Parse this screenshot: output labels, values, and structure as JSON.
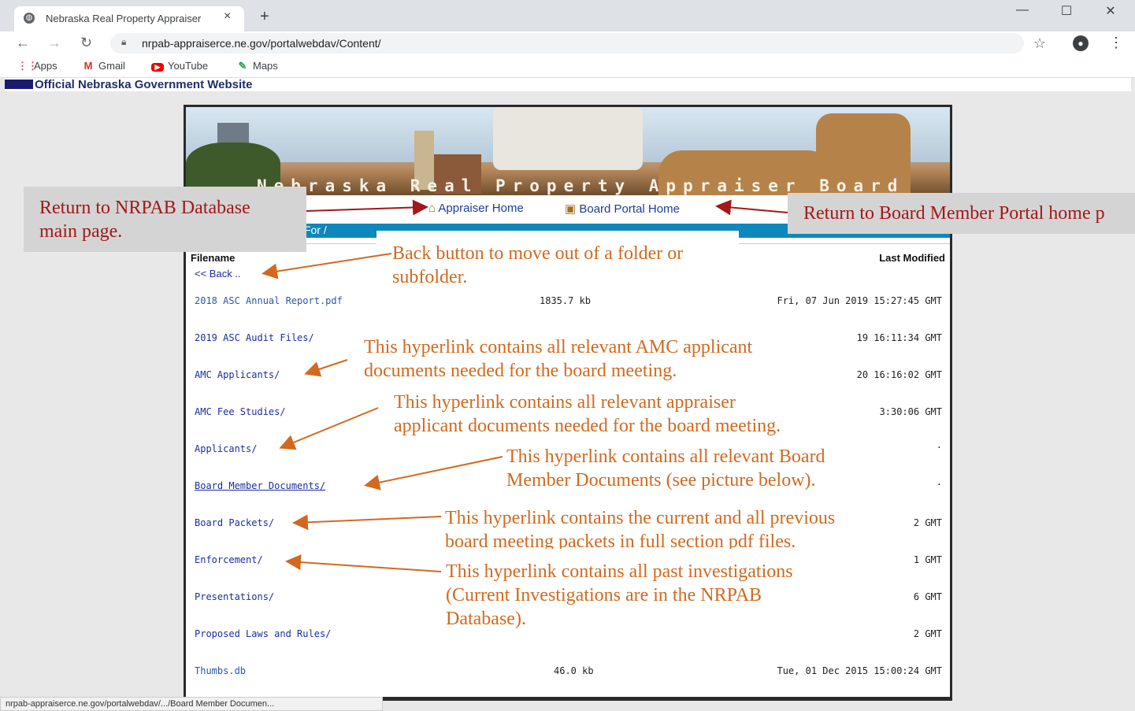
{
  "browser": {
    "tab_title": "Nebraska Real Property Appraiser",
    "tab_close": "×",
    "new_tab": "+",
    "url": "nrpab-appraiserce.ne.gov/portalwebdav/Content/",
    "bookmarks": [
      {
        "label": "Apps",
        "icon": "apps-grid-icon"
      },
      {
        "label": "Gmail",
        "icon": "gmail-icon"
      },
      {
        "label": "YouTube",
        "icon": "youtube-icon"
      },
      {
        "label": "Maps",
        "icon": "maps-icon"
      }
    ],
    "status_url": "nrpab-appraiserce.ne.gov/portalwebdav/.../Board Member Documen..."
  },
  "page": {
    "gov_banner": "Official Nebraska Government Website",
    "banner_title": "Nebraska Real Property Appraiser Board",
    "nav": {
      "appraiser_home": "Appraiser Home",
      "board_portal_home": "Board Portal Home"
    },
    "bluebar_text": "For /",
    "header": {
      "filename": "Filename",
      "last_modified": "Last Modified"
    },
    "back": "<< Back ..",
    "files": [
      {
        "name": "2018 ASC Annual Report.pdf",
        "size": "1835.7 kb",
        "modified": "Fri, 07 Jun 2019 15:27:45 GMT"
      },
      {
        "name": "2019 ASC Audit Files/",
        "size": "",
        "modified": "19 16:11:34 GMT"
      },
      {
        "name": "AMC Applicants/",
        "size": "",
        "modified": "20 16:16:02 GMT"
      },
      {
        "name": "AMC Fee Studies/",
        "size": "",
        "modified": "3:30:06 GMT"
      },
      {
        "name": "Applicants/",
        "size": "",
        "modified": "."
      },
      {
        "name": "Board Member Documents/",
        "size": "",
        "modified": "."
      },
      {
        "name": "Board Packets/",
        "size": "",
        "modified": "2 GMT"
      },
      {
        "name": "Enforcement/",
        "size": "",
        "modified": "1 GMT"
      },
      {
        "name": "Presentations/",
        "size": "",
        "modified": "6 GMT"
      },
      {
        "name": "Proposed Laws and Rules/",
        "size": "",
        "modified": "2 GMT"
      },
      {
        "name": "Thumbs.db",
        "size": "46.0 kb",
        "modified": "Tue, 01 Dec 2015 15:00:24 GMT"
      }
    ]
  },
  "annotations": {
    "nrpab_db": [
      "Return to NRPAB Database",
      "main page."
    ],
    "board_portal": "Return to Board Member Portal home p",
    "back": [
      "Back button to move out of a folder or",
      "subfolder."
    ],
    "amc": [
      "This hyperlink contains all relevant AMC applicant",
      "documents needed for the board meeting."
    ],
    "applicants": [
      "This hyperlink contains all relevant appraiser",
      "applicant documents needed for the board meeting."
    ],
    "board_docs": [
      "This hyperlink contains all relevant Board",
      "Member Documents (see picture below)."
    ],
    "packets": [
      "This hyperlink contains the current and all previous",
      "board meeting packets in full section pdf files."
    ],
    "enforcement": [
      "This hyperlink contains all past investigations",
      "(Current Investigations are in the NRPAB",
      "Database)."
    ]
  },
  "colors": {
    "annotation_orange": "#d2691e",
    "annotation_red": "#a31818",
    "link_blue": "#1b2da0",
    "bluebar": "#0e87bd"
  }
}
